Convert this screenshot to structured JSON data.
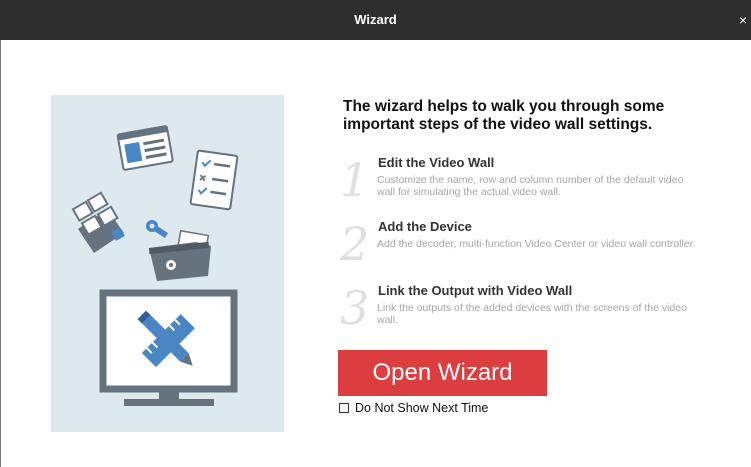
{
  "window": {
    "title": "Wizard",
    "close_glyph": "×"
  },
  "heading": "The wizard helps to walk you through some important steps of the video wall settings.",
  "steps": [
    {
      "number": "1",
      "title": "Edit the Video Wall",
      "description": "Customize the name, row and column number of the default video wall for simulating the actual video wall."
    },
    {
      "number": "2",
      "title": "Add the Device",
      "description": "Add the decoder, multi-function Video Center or video wall controller."
    },
    {
      "number": "3",
      "title": "Link the Output with Video Wall",
      "description": "Link the outputs of the added devices with the screens of the video wall."
    }
  ],
  "open_wizard_label": "Open Wizard",
  "do_not_show_label": "Do Not Show Next Time",
  "do_not_show_checked": false,
  "colors": {
    "title_bar": "#2e2e2e",
    "accent_button": "#dc3d3f",
    "illustration_bg": "#dde8ef",
    "illustration_blue": "#4b86c4",
    "illustration_dark": "#65737e"
  },
  "icons": [
    "close-icon",
    "window-card-icon",
    "checklist-icon",
    "layout-grid-icon",
    "wrench-toolbox-icon",
    "monitor-pencil-ruler-icon"
  ]
}
